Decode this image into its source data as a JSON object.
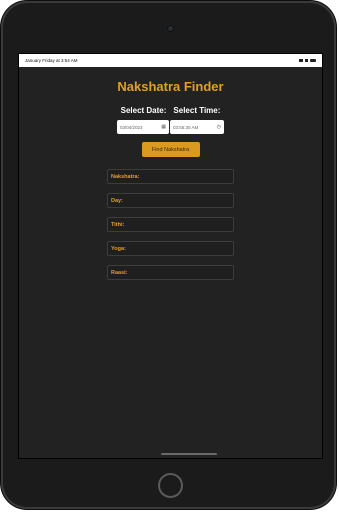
{
  "status_bar": {
    "time_date": "January Friday at 3:54 AM"
  },
  "app": {
    "title": "Nakshatra Finder",
    "select_date_label": "Select Date:",
    "select_time_label": "Select Time:",
    "date_value": "03/04/2023",
    "time_value": "03:55:30 AM",
    "find_button": "Find Nakshatra"
  },
  "results": [
    {
      "label": "Nakshatra:"
    },
    {
      "label": "Day:"
    },
    {
      "label": "Tithi:"
    },
    {
      "label": "Yoga:"
    },
    {
      "label": "Raasi:"
    }
  ],
  "colors": {
    "accent": "#e0a020",
    "button": "#d99a1f",
    "background": "#222222"
  },
  "icons": {
    "date_icon": "calendar-icon",
    "time_icon": "clock-icon"
  }
}
